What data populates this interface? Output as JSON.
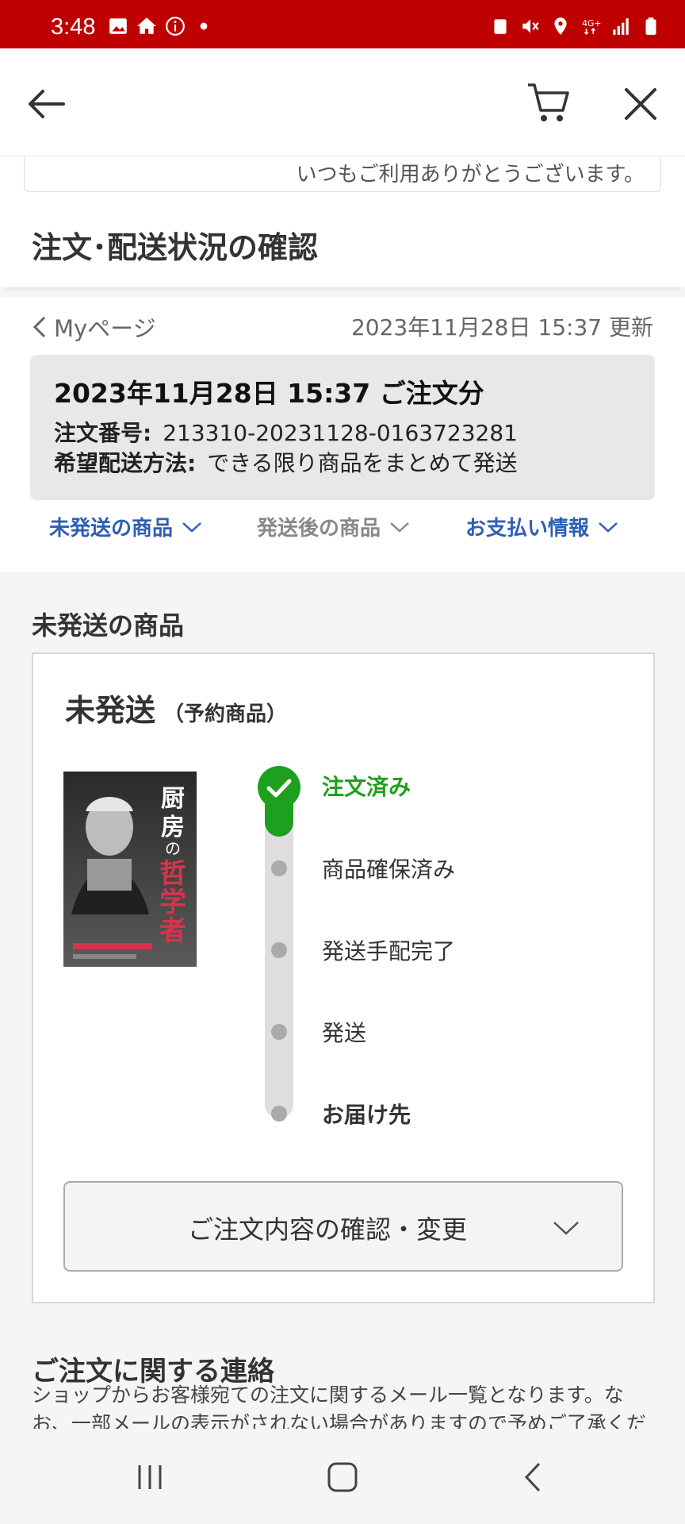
{
  "status_bar": {
    "time": "3:48",
    "left_icons": [
      "gallery-icon",
      "home-icon",
      "info-icon",
      "dot-icon"
    ],
    "right_icons": [
      "recycle-icon",
      "mute-icon",
      "location-icon",
      "network-4g-icon",
      "signal-icon",
      "battery-icon"
    ],
    "background": "#bf0000"
  },
  "header": {
    "back_icon": "arrow-left-icon",
    "cart_icon": "cart-icon",
    "close_icon": "close-icon"
  },
  "greeting": "いつもご利用ありがとうございます。",
  "page_title": "注文･配送状況の確認",
  "breadcrumb": {
    "link": "Myページ",
    "updated": "2023年11月28日 15:37 更新"
  },
  "order": {
    "heading": "2023年11月28日 15:37 ご注文分",
    "number_label": "注文番号:",
    "number_value": "213310-20231128-0163723281",
    "shipping_label": "希望配送方法:",
    "shipping_value": "できる限り商品をまとめて発送"
  },
  "tabs": [
    {
      "label": "未発送の商品",
      "color": "#2f5fb3"
    },
    {
      "label": "発送後の商品",
      "color": "#888888"
    },
    {
      "label": "お支払い情報",
      "color": "#2f5fb3"
    }
  ],
  "section_title": "未発送の商品",
  "card": {
    "status": "未発送",
    "status_sub": "（予約商品）",
    "book_title": "厨房の哲学者",
    "steps": [
      {
        "label": "注文済み",
        "state": "done"
      },
      {
        "label": "商品確保済み",
        "state": "pending"
      },
      {
        "label": "発送手配完了",
        "state": "pending"
      },
      {
        "label": "発送",
        "state": "pending"
      },
      {
        "label": "お届け先",
        "state": "pending"
      }
    ],
    "confirm_button": "ご注文内容の確認・変更",
    "accent_green": "#1da01d"
  },
  "contact": {
    "title": "ご注文に関する連絡",
    "text": "ショップからお客様宛ての注文に関するメール一覧となります。なお、一部メールの表示がされない場合がありますので予めご了承くだ"
  },
  "nav_bar": [
    "recent-apps-icon",
    "home-button-icon",
    "back-nav-icon"
  ]
}
